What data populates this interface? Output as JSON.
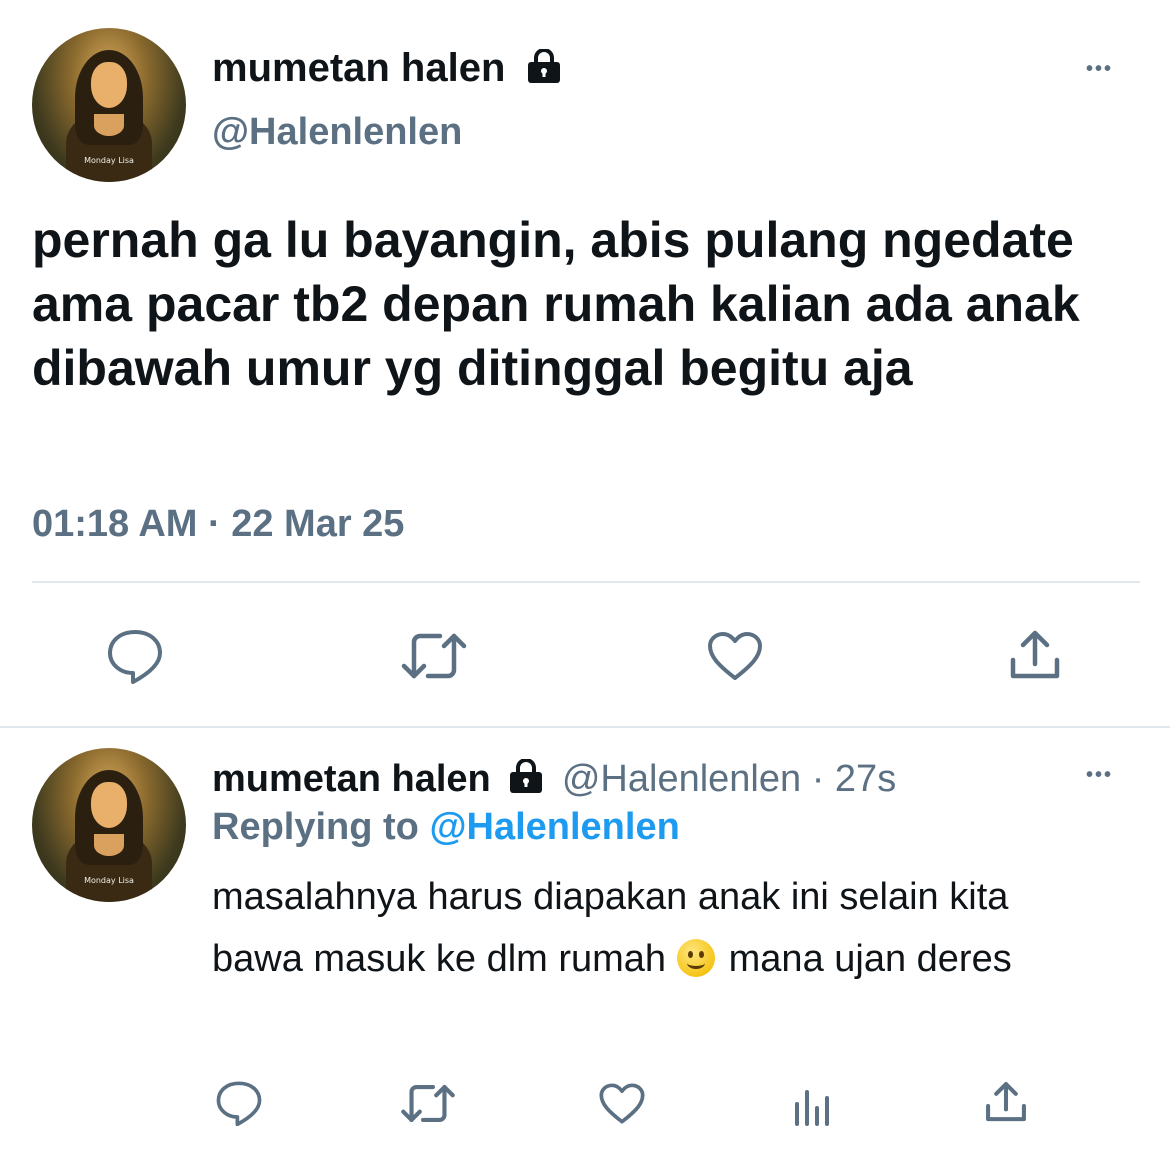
{
  "main_tweet": {
    "display_name": "mumetan halen",
    "handle": "@Halenlenlen",
    "avatar_caption": "Monday Lisa",
    "text": "pernah ga lu bayangin, abis pulang ngedate ama pacar tb2 depan rumah kalian ada anak dibawah umur yg ditinggal begitu aja",
    "time": "01:18 AM",
    "separator": "·",
    "date": "22 Mar 25",
    "more": "•••"
  },
  "reply": {
    "display_name": "mumetan halen",
    "handle": "@Halenlenlen",
    "separator": "·",
    "age": "27s",
    "replying_label": "Replying to",
    "replying_handle": "@Halenlenlen",
    "avatar_caption": "Monday Lisa",
    "text_part1": "masalahnya harus diapakan anak ini selain kita bawa masuk ke dlm rumah",
    "text_part2": "mana ujan deres",
    "more": "•••"
  },
  "icons": [
    "lock-icon",
    "reply-icon",
    "retweet-icon",
    "like-icon",
    "share-icon",
    "analytics-icon",
    "more-icon"
  ],
  "colors": {
    "accent": "#1d9bf0",
    "muted": "#5b7083",
    "text": "#0f1419",
    "divider": "#e1e8ed"
  }
}
